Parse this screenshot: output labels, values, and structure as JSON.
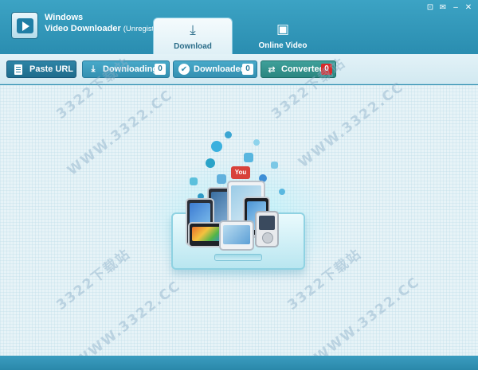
{
  "app": {
    "title_line1": "Windows",
    "title_line2": "Video Downloader",
    "registration": "(Unregistered)"
  },
  "window_controls": [
    {
      "name": "settings-icon",
      "glyph": "⊡"
    },
    {
      "name": "feedback-icon",
      "glyph": "✉"
    },
    {
      "name": "minimize-icon",
      "glyph": "–"
    },
    {
      "name": "close-icon",
      "glyph": "✕"
    }
  ],
  "tabs": [
    {
      "label": "Download",
      "icon": "download-icon",
      "glyph": "⤓",
      "active": true
    },
    {
      "label": "Online Video",
      "icon": "video-camera-icon",
      "glyph": "▣",
      "active": false
    }
  ],
  "toolbar": {
    "paste_label": "Paste URL",
    "downloading_label": "Downloading",
    "downloading_count": "0",
    "downloaded_label": "Downloaded",
    "downloaded_count": "0",
    "converted_label": "Converted",
    "converted_count": "0"
  },
  "illustration": {
    "youtube_badge": "You"
  },
  "watermarks": [
    "3322下载站",
    "WWW.3322.CC"
  ],
  "colors": {
    "titlebar": "#2c8eb0",
    "toolbar_button": "#3490b1",
    "converted_button": "#2b8680",
    "converted_badge": "#d9292a"
  }
}
